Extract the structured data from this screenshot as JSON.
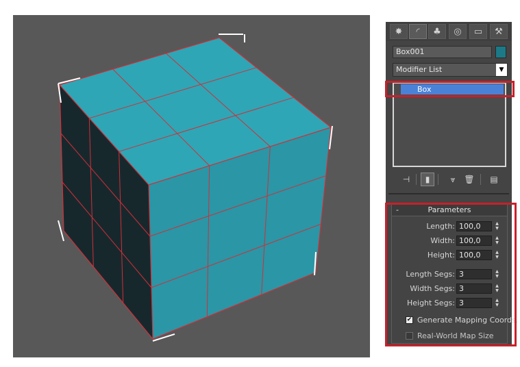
{
  "command_panel": {
    "tabs": [
      {
        "icon": "create-icon",
        "glyph": "✸"
      },
      {
        "icon": "modify-icon",
        "glyph": "◜"
      },
      {
        "icon": "hierarchy-icon",
        "glyph": "♣"
      },
      {
        "icon": "motion-icon",
        "glyph": "◎"
      },
      {
        "icon": "display-icon",
        "glyph": "▭"
      },
      {
        "icon": "utilities-icon",
        "glyph": "⚒"
      }
    ],
    "object_name": "Box001",
    "object_color": "#1c7a88",
    "modifier_list": "Modifier List",
    "stack": {
      "items": [
        {
          "label": "Box"
        }
      ]
    },
    "stack_tools": [
      {
        "icon": "pin-stack-icon",
        "glyph": "⊣"
      },
      {
        "icon": "show-end-result-icon",
        "glyph": "▮"
      },
      {
        "icon": "make-unique-icon",
        "glyph": "⩔"
      },
      {
        "icon": "remove-modifier-icon",
        "glyph": "🗑"
      },
      {
        "icon": "configure-modifier-sets-icon",
        "glyph": "▤"
      }
    ],
    "parameters": {
      "title": "Parameters",
      "collapse": "-",
      "length_label": "Length:",
      "length_value": "100,0",
      "width_label": "Width:",
      "width_value": "100,0",
      "height_label": "Height:",
      "height_value": "100,0",
      "length_segs_label": "Length Segs:",
      "length_segs_value": "3",
      "width_segs_label": "Width Segs:",
      "width_segs_value": "3",
      "height_segs_label": "Height Segs:",
      "height_segs_value": "3",
      "gen_mapping_label": "Generate Mapping Coords.",
      "gen_mapping_checked": true,
      "real_world_label": "Real-World Map Size",
      "real_world_checked": false
    }
  },
  "viewport": {
    "background": "#585858",
    "object_color": "#2ea6b6",
    "edge_color": "#d03038"
  }
}
